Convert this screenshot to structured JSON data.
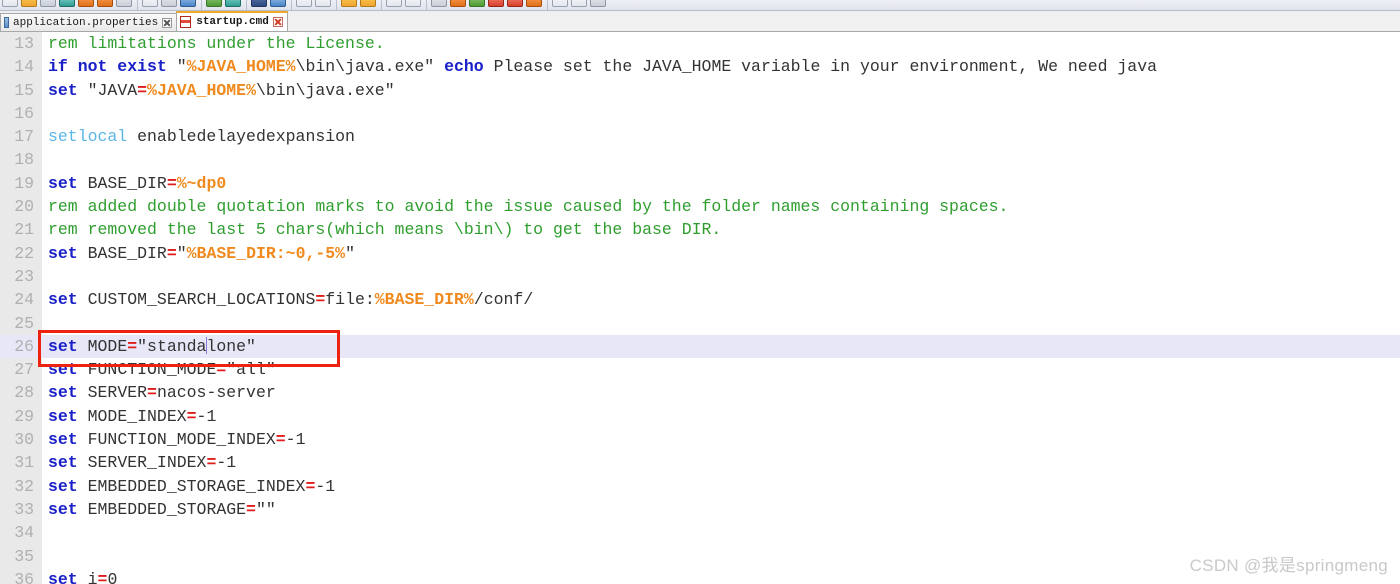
{
  "toolbar": {
    "groups": [
      {
        "name": "file-group",
        "icons": [
          {
            "name": "new-file-icon",
            "color": "c-white"
          },
          {
            "name": "open-folder-icon",
            "color": "c-yellow"
          },
          {
            "name": "save-icon",
            "color": "c-grey"
          },
          {
            "name": "save-all-icon",
            "color": "c-teal"
          },
          {
            "name": "close-file-icon",
            "color": "c-orange"
          },
          {
            "name": "close-all-icon",
            "color": "c-orange"
          },
          {
            "name": "print-icon",
            "color": "c-grey"
          }
        ]
      },
      {
        "name": "edit-group",
        "icons": [
          {
            "name": "cut-icon",
            "color": "c-white"
          },
          {
            "name": "copy-icon",
            "color": "c-grey"
          },
          {
            "name": "paste-icon",
            "color": "c-blue"
          }
        ]
      },
      {
        "name": "history-group",
        "icons": [
          {
            "name": "undo-icon",
            "color": "c-green"
          },
          {
            "name": "redo-icon",
            "color": "c-teal"
          }
        ]
      },
      {
        "name": "search-group",
        "icons": [
          {
            "name": "find-icon",
            "color": "c-navy"
          },
          {
            "name": "replace-icon",
            "color": "c-blue"
          }
        ]
      },
      {
        "name": "zoom-group",
        "icons": [
          {
            "name": "zoom-in-icon",
            "color": "c-white"
          },
          {
            "name": "zoom-out-icon",
            "color": "c-white"
          }
        ]
      },
      {
        "name": "view-group",
        "icons": [
          {
            "name": "sync-scroll-icon",
            "color": "c-yellow"
          },
          {
            "name": "sync-view-icon",
            "color": "c-yellow"
          }
        ]
      },
      {
        "name": "format-group",
        "icons": [
          {
            "name": "word-wrap-icon",
            "color": "c-white"
          },
          {
            "name": "show-symbols-icon",
            "color": "c-white"
          }
        ]
      },
      {
        "name": "macro-group",
        "icons": [
          {
            "name": "record-macro-icon",
            "color": "c-grey"
          },
          {
            "name": "stop-macro-icon",
            "color": "c-orange"
          },
          {
            "name": "play-macro-icon",
            "color": "c-green"
          },
          {
            "name": "save-macro-icon",
            "color": "c-red"
          },
          {
            "name": "run-macro-icon",
            "color": "c-red"
          },
          {
            "name": "run-multi-icon",
            "color": "c-orange"
          }
        ]
      },
      {
        "name": "panel-group",
        "icons": [
          {
            "name": "document-map-icon",
            "color": "c-white"
          },
          {
            "name": "function-list-icon",
            "color": "c-white"
          },
          {
            "name": "folder-explorer-icon",
            "color": "c-grey"
          }
        ]
      }
    ]
  },
  "tabs": [
    {
      "label": "application.properties",
      "active": false,
      "close_label": "x"
    },
    {
      "label": "startup.cmd",
      "active": true,
      "close_label": "x"
    }
  ],
  "editor": {
    "first_line_number": 13,
    "highlighted_line": 26,
    "caret_line": 26,
    "lines": [
      {
        "n": 13,
        "tokens": [
          {
            "t": "rem limitations under the License.",
            "c": "t-comment"
          }
        ]
      },
      {
        "n": 14,
        "tokens": [
          {
            "t": "if not exist ",
            "c": "t-kw"
          },
          {
            "t": "\"",
            "c": "t-plain"
          },
          {
            "t": "%JAVA_HOME%",
            "c": "t-var"
          },
          {
            "t": "\\bin\\java.exe\" ",
            "c": "t-plain"
          },
          {
            "t": "echo",
            "c": "t-kw"
          },
          {
            "t": " Please set the JAVA_HOME variable in your environment, We need java",
            "c": "t-plain"
          }
        ]
      },
      {
        "n": 15,
        "tokens": [
          {
            "t": "set",
            "c": "t-kw"
          },
          {
            "t": " \"JAVA",
            "c": "t-plain"
          },
          {
            "t": "=",
            "c": "t-op"
          },
          {
            "t": "%JAVA_HOME%",
            "c": "t-var"
          },
          {
            "t": "\\bin\\java.exe\"",
            "c": "t-plain"
          }
        ]
      },
      {
        "n": 16,
        "tokens": []
      },
      {
        "n": 17,
        "tokens": [
          {
            "t": "setlocal",
            "c": "t-kw2"
          },
          {
            "t": " enabledelayedexpansion",
            "c": "t-plain"
          }
        ]
      },
      {
        "n": 18,
        "tokens": []
      },
      {
        "n": 19,
        "tokens": [
          {
            "t": "set",
            "c": "t-kw"
          },
          {
            "t": " BASE_DIR",
            "c": "t-plain"
          },
          {
            "t": "=",
            "c": "t-op"
          },
          {
            "t": "%~dp0",
            "c": "t-var"
          }
        ]
      },
      {
        "n": 20,
        "tokens": [
          {
            "t": "rem added double quotation marks to avoid the issue caused by the folder names containing spaces.",
            "c": "t-comment"
          }
        ]
      },
      {
        "n": 21,
        "tokens": [
          {
            "t": "rem removed the last 5 chars(which means \\bin\\) to get the base DIR.",
            "c": "t-comment"
          }
        ]
      },
      {
        "n": 22,
        "tokens": [
          {
            "t": "set",
            "c": "t-kw"
          },
          {
            "t": " BASE_DIR",
            "c": "t-plain"
          },
          {
            "t": "=",
            "c": "t-op"
          },
          {
            "t": "\"",
            "c": "t-plain"
          },
          {
            "t": "%BASE_DIR:~0,-5%",
            "c": "t-var"
          },
          {
            "t": "\"",
            "c": "t-plain"
          }
        ]
      },
      {
        "n": 23,
        "tokens": []
      },
      {
        "n": 24,
        "tokens": [
          {
            "t": "set",
            "c": "t-kw"
          },
          {
            "t": " CUSTOM_SEARCH_LOCATIONS",
            "c": "t-plain"
          },
          {
            "t": "=",
            "c": "t-op"
          },
          {
            "t": "file:",
            "c": "t-plain"
          },
          {
            "t": "%BASE_DIR%",
            "c": "t-var"
          },
          {
            "t": "/conf/",
            "c": "t-plain"
          }
        ]
      },
      {
        "n": 25,
        "tokens": []
      },
      {
        "n": 26,
        "tokens": [
          {
            "t": "set",
            "c": "t-kw"
          },
          {
            "t": " MODE",
            "c": "t-plain"
          },
          {
            "t": "=",
            "c": "t-op"
          },
          {
            "t": "\"standa",
            "c": "t-plain"
          },
          {
            "t": "|CARET|",
            "c": "caret"
          },
          {
            "t": "lone\"",
            "c": "t-plain"
          }
        ]
      },
      {
        "n": 27,
        "tokens": [
          {
            "t": "set",
            "c": "t-kw"
          },
          {
            "t": " FUNCTION_MODE",
            "c": "t-plain"
          },
          {
            "t": "=",
            "c": "t-op"
          },
          {
            "t": "\"all\"",
            "c": "t-plain"
          }
        ]
      },
      {
        "n": 28,
        "tokens": [
          {
            "t": "set",
            "c": "t-kw"
          },
          {
            "t": " SERVER",
            "c": "t-plain"
          },
          {
            "t": "=",
            "c": "t-op"
          },
          {
            "t": "nacos-server",
            "c": "t-plain"
          }
        ]
      },
      {
        "n": 29,
        "tokens": [
          {
            "t": "set",
            "c": "t-kw"
          },
          {
            "t": " MODE_INDEX",
            "c": "t-plain"
          },
          {
            "t": "=",
            "c": "t-op"
          },
          {
            "t": "-1",
            "c": "t-plain"
          }
        ]
      },
      {
        "n": 30,
        "tokens": [
          {
            "t": "set",
            "c": "t-kw"
          },
          {
            "t": " FUNCTION_MODE_INDEX",
            "c": "t-plain"
          },
          {
            "t": "=",
            "c": "t-op"
          },
          {
            "t": "-1",
            "c": "t-plain"
          }
        ]
      },
      {
        "n": 31,
        "tokens": [
          {
            "t": "set",
            "c": "t-kw"
          },
          {
            "t": " SERVER_INDEX",
            "c": "t-plain"
          },
          {
            "t": "=",
            "c": "t-op"
          },
          {
            "t": "-1",
            "c": "t-plain"
          }
        ]
      },
      {
        "n": 32,
        "tokens": [
          {
            "t": "set",
            "c": "t-kw"
          },
          {
            "t": " EMBEDDED_STORAGE_INDEX",
            "c": "t-plain"
          },
          {
            "t": "=",
            "c": "t-op"
          },
          {
            "t": "-1",
            "c": "t-plain"
          }
        ]
      },
      {
        "n": 33,
        "tokens": [
          {
            "t": "set",
            "c": "t-kw"
          },
          {
            "t": " EMBEDDED_STORAGE",
            "c": "t-plain"
          },
          {
            "t": "=",
            "c": "t-op"
          },
          {
            "t": "\"\"",
            "c": "t-plain"
          }
        ]
      },
      {
        "n": 34,
        "tokens": []
      },
      {
        "n": 35,
        "tokens": []
      },
      {
        "n": 36,
        "tokens": [
          {
            "t": "set",
            "c": "t-kw"
          },
          {
            "t": " i",
            "c": "t-plain"
          },
          {
            "t": "=",
            "c": "t-op"
          },
          {
            "t": "0",
            "c": "t-plain"
          }
        ]
      }
    ]
  },
  "annotation": {
    "name": "red-highlight-box",
    "target_line": 26,
    "color": "#ee2211"
  },
  "watermark": {
    "text": "CSDN @我是springmeng"
  },
  "colors": {
    "comment": "#2f9e2f",
    "keyword": "#1a20c8",
    "keyword_alt": "#5bb6e8",
    "variable": "#f08a1e",
    "operator": "#e01b1b",
    "plain": "#333333",
    "gutter_bg": "#e9e9e9",
    "line_number": "#b0b0b0",
    "highlight_row": "#e7e7f8",
    "annotation": "#ee2211",
    "tab_active_accent": "#f0a930"
  }
}
